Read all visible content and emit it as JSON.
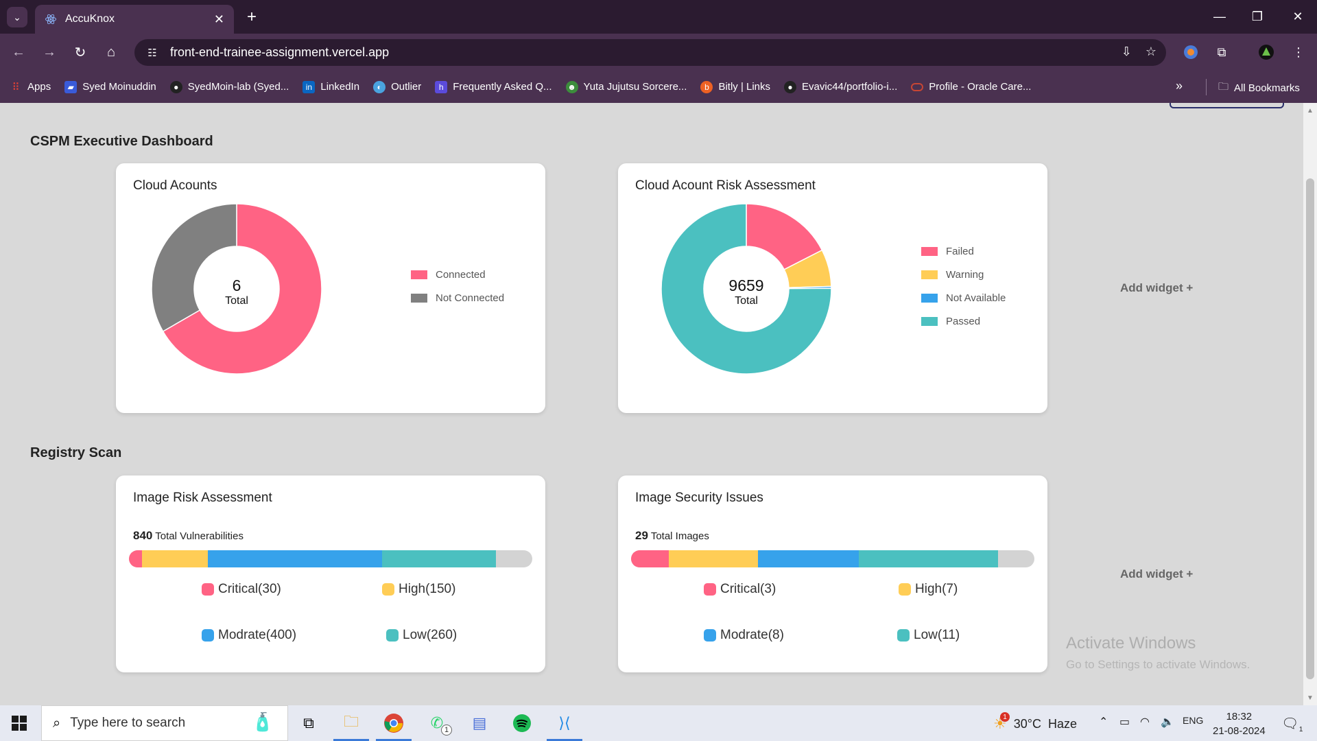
{
  "browser": {
    "tab_title": "AccuKnox",
    "url": "front-end-trainee-assignment.vercel.app",
    "bookmarks": [
      {
        "label": "Apps",
        "icon": "apps-grid-icon",
        "color": "#e94235"
      },
      {
        "label": "Syed Moinuddin",
        "icon": "bookmark-icon",
        "color": "#3a5bd9"
      },
      {
        "label": "SyedMoin-lab (Syed...",
        "icon": "github-icon",
        "color": "#222222"
      },
      {
        "label": "LinkedIn",
        "icon": "linkedin-icon",
        "color": "#0a66c2"
      },
      {
        "label": "Outlier",
        "icon": "outlier-icon",
        "color": "#4aa3df"
      },
      {
        "label": "Frequently Asked Q...",
        "icon": "faq-icon",
        "color": "#5b4bdb"
      },
      {
        "label": "Yuta Jujutsu Sorcere...",
        "icon": "anime-icon",
        "color": "#3c8d3c"
      },
      {
        "label": "Bitly | Links",
        "icon": "bitly-icon",
        "color": "#ee6123"
      },
      {
        "label": "Evavic44/portfolio-i...",
        "icon": "github-icon",
        "color": "#222222"
      },
      {
        "label": "Profile - Oracle Care...",
        "icon": "oracle-icon",
        "color": "#c74634"
      }
    ],
    "all_bookmarks_label": "All Bookmarks"
  },
  "dashboard": {
    "sections": [
      {
        "title": "CSPM Executive Dashboard"
      },
      {
        "title": "Registry Scan"
      }
    ],
    "add_widget_label": "Add widget +",
    "cloud_accounts": {
      "title": "Cloud Acounts",
      "total_value": "6",
      "total_label": "Total",
      "legend": [
        {
          "label": "Connected",
          "color": "#ff6384"
        },
        {
          "label": "Not Connected",
          "color": "#808080"
        }
      ]
    },
    "risk_assessment": {
      "title": "Cloud Acount Risk Assessment",
      "total_value": "9659",
      "total_label": "Total",
      "legend": [
        {
          "label": "Failed",
          "color": "#ff6384"
        },
        {
          "label": "Warning",
          "color": "#ffcd56"
        },
        {
          "label": "Not Available",
          "color": "#36a2eb"
        },
        {
          "label": "Passed",
          "color": "#4bc0c0"
        }
      ]
    },
    "image_risk": {
      "title": "Image Risk Assessment",
      "total_value": "840",
      "total_label": "Total Vulnerabilities",
      "legend": [
        {
          "label": "Critical(30)",
          "color": "#ff6384"
        },
        {
          "label": "High(150)",
          "color": "#ffcd56"
        },
        {
          "label": "Modrate(400)",
          "color": "#36a2eb"
        },
        {
          "label": "Low(260)",
          "color": "#4bc0c0"
        }
      ]
    },
    "image_security": {
      "title": "Image Security Issues",
      "total_value": "29",
      "total_label": "Total Images",
      "legend": [
        {
          "label": "Critical(3)",
          "color": "#ff6384"
        },
        {
          "label": "High(7)",
          "color": "#ffcd56"
        },
        {
          "label": "Modrate(8)",
          "color": "#36a2eb"
        },
        {
          "label": "Low(11)",
          "color": "#4bc0c0"
        }
      ]
    }
  },
  "watermark": {
    "line1": "Activate Windows",
    "line2": "Go to Settings to activate Windows."
  },
  "taskbar": {
    "search_placeholder": "Type here to search",
    "weather": "30°C  Haze",
    "language": "ENG",
    "time": "18:32",
    "date": "21-08-2024",
    "notification_count": "1",
    "whatsapp_badge": "1",
    "weather_badge": "1"
  },
  "chart_data": [
    {
      "type": "pie",
      "title": "Cloud Acounts",
      "categories": [
        "Connected",
        "Not Connected"
      ],
      "values": [
        4,
        2
      ],
      "total": 6
    },
    {
      "type": "pie",
      "title": "Cloud Acount Risk Assessment",
      "categories": [
        "Failed",
        "Warning",
        "Not Available",
        "Passed"
      ],
      "values": [
        1689,
        681,
        36,
        7253
      ],
      "total": 9659
    },
    {
      "type": "bar",
      "title": "Image Risk Assessment",
      "categories": [
        "Critical",
        "High",
        "Modrate",
        "Low"
      ],
      "values": [
        30,
        150,
        400,
        260
      ],
      "total": 840
    },
    {
      "type": "bar",
      "title": "Image Security Issues",
      "categories": [
        "Critical",
        "High",
        "Modrate",
        "Low"
      ],
      "values": [
        3,
        7,
        8,
        11
      ],
      "total": 29
    }
  ]
}
